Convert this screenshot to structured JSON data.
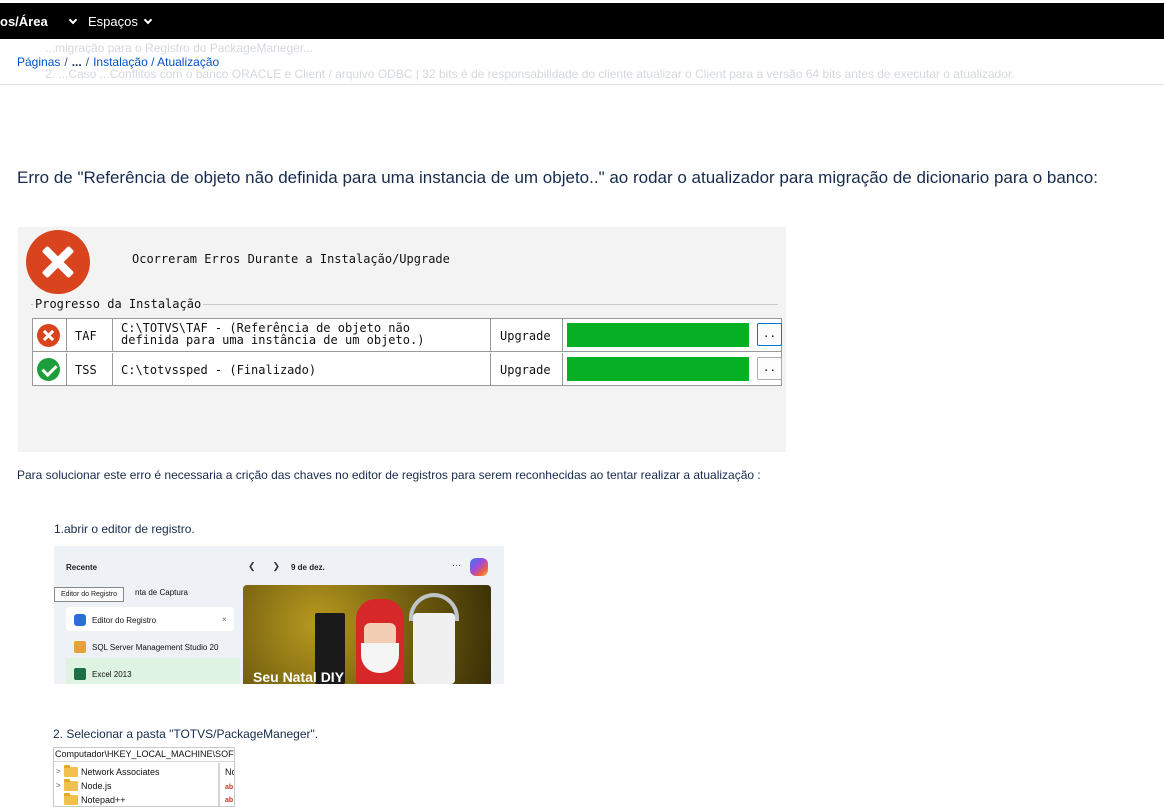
{
  "topnav": {
    "area_label": "os/Área",
    "spaces_label": "Espaços"
  },
  "ghost": {
    "line1": "...migração para o Registro do PackageManeger...",
    "line2": "2. ...Caso ...Conflitos com o banco ORACLE e Client / arquivo ODBC | 32 bits é de responsabilidade do cliente atualizar o Client para a versão 64 bits antes de executar o atualizador."
  },
  "breadcrumb": {
    "root": "Páginas",
    "ellipsis": "...",
    "current": "Instalação / Atualização"
  },
  "heading": "Erro  de \"Referência de objeto não definida para uma instancia de um objeto..\" ao rodar o atualizador para migração de dicionario para o banco:",
  "installer": {
    "title": "Ocorreram Erros Durante a Instalação/Upgrade",
    "group_label": "Progresso da Instalação",
    "rows": [
      {
        "status": "error",
        "name": "TAF",
        "path_line1": "C:\\TOTVS\\TAF - (Referência de objeto não",
        "path_line2": "definida para uma instância de um objeto.)",
        "type": "Upgrade",
        "progress": 1.0,
        "button": ".."
      },
      {
        "status": "success",
        "name": "TSS",
        "path_line1": "C:\\totvssped - (Finalizado)",
        "path_line2": "",
        "type": "Upgrade",
        "progress": 1.0,
        "button": ".."
      }
    ],
    "colors": {
      "error": "#d9441e",
      "success": "#1e9e3a",
      "progress": "#06b025"
    }
  },
  "solution_text": "Para solucionar este erro  é necessaria a crição das chaves no editor de registros para serem reconhecidas ao tentar realizar a atualização :",
  "step1": "1.abrir o editor de registro.",
  "startmenu": {
    "recent_label": "Recente",
    "tooltip": "Editor do Registro",
    "items": [
      "Ferramenta de Captura",
      "Editor do Registro",
      "SQL Server Management Studio 20",
      "Excel 2013"
    ],
    "item0_visible": "nta de Captura",
    "close_glyph": "×",
    "date": "9 de dez.",
    "more": "···",
    "card_title": "Seu Natal DIY"
  },
  "step2": "2. Selecionar a pasta \"TOTVS/PackageManeger\".",
  "regedit": {
    "path": "Computador\\HKEY_LOCAL_MACHINE\\SOFT",
    "folders": [
      "Network Associates",
      "Node.js",
      "Notepad++"
    ],
    "right_header": "No",
    "right_value_glyph": "ab"
  }
}
